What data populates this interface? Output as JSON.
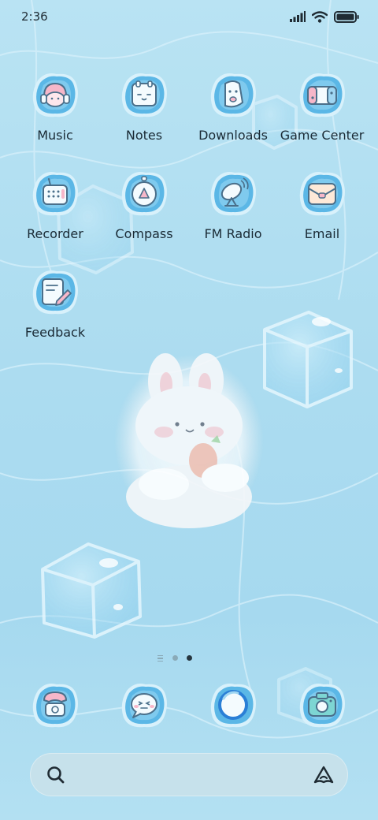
{
  "status_bar": {
    "time": "2:36",
    "icons": [
      "signal-icon",
      "wifi-icon",
      "battery-icon"
    ]
  },
  "home": {
    "rows": [
      [
        {
          "label": "Music",
          "icon": "music-icon"
        },
        {
          "label": "Notes",
          "icon": "notes-icon"
        },
        {
          "label": "Downloads",
          "icon": "downloads-icon"
        },
        {
          "label": "Game Center",
          "icon": "game-center-icon"
        }
      ],
      [
        {
          "label": "Recorder",
          "icon": "recorder-icon"
        },
        {
          "label": "Compass",
          "icon": "compass-icon"
        },
        {
          "label": "FM Radio",
          "icon": "fm-radio-icon"
        },
        {
          "label": "Email",
          "icon": "email-icon"
        }
      ],
      [
        {
          "label": "Feedback",
          "icon": "feedback-icon"
        }
      ]
    ]
  },
  "pager": {
    "pages": 3,
    "current": 3,
    "first_is_feed": true
  },
  "dock": {
    "items": [
      {
        "icon": "phone-icon"
      },
      {
        "icon": "messages-icon"
      },
      {
        "icon": "browser-icon"
      },
      {
        "icon": "camera-icon"
      }
    ]
  },
  "search_bar": {
    "icons": [
      "search-icon",
      "assistant-icon"
    ]
  },
  "colors": {
    "background": "#acdcf0",
    "tile_blue": "#5bb7e6",
    "tile_rim": "#d8f1fb",
    "icon_white": "#f4fbfe",
    "outline": "#4a6f8a",
    "pink": "#f7b7c9",
    "text": "#1a2a35"
  }
}
